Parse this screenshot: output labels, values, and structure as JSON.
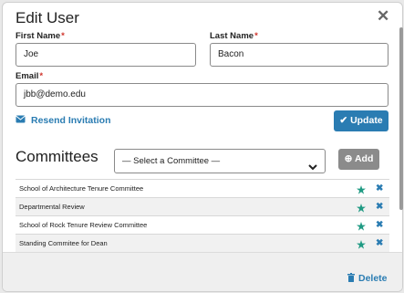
{
  "dialog": {
    "title": "Edit User",
    "close_icon": "close-icon"
  },
  "form": {
    "first_name_label": "First Name",
    "first_name_value": "Joe",
    "last_name_label": "Last Name",
    "last_name_value": "Bacon",
    "email_label": "Email",
    "email_value": "jbb@demo.edu",
    "required_marker": "*"
  },
  "actions": {
    "resend_label": "Resend Invitation",
    "update_label": "Update",
    "delete_label": "Delete"
  },
  "committees": {
    "title": "Committees",
    "select_value": "— Select a Committee —",
    "add_label": "Add",
    "items": [
      "School of Architecture Tenure Committee",
      "Departmental Review",
      "School of Rock Tenure Review Committee",
      "Standing Commitee for Dean"
    ]
  },
  "colors": {
    "accent": "#2a7cb2",
    "star": "#1f9a83",
    "required": "#d0342c"
  }
}
